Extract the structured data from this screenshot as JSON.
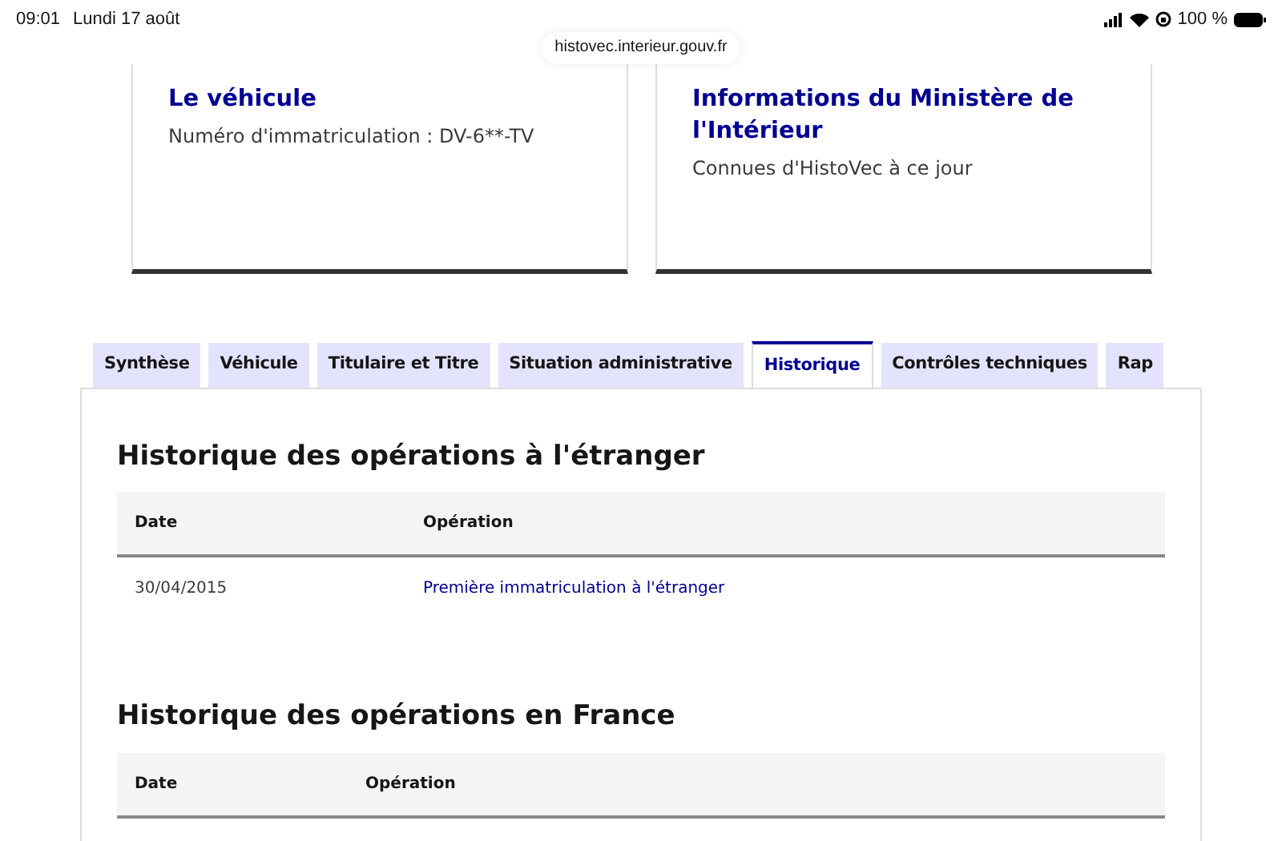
{
  "status_bar": {
    "time": "09:01",
    "date": "Lundi 17 août",
    "battery": "100 %",
    "url": "histovec.interieur.gouv.fr"
  },
  "cards": [
    {
      "title": "Le véhicule",
      "text": "Numéro d'immatriculation : DV-6**-TV"
    },
    {
      "title": "Informations du Ministère de l'Intérieur",
      "text": "Connues d'HistoVec à ce jour"
    }
  ],
  "tabs": [
    {
      "label": "Synthèse",
      "selected": false
    },
    {
      "label": "Véhicule",
      "selected": false
    },
    {
      "label": "Titulaire et Titre",
      "selected": false
    },
    {
      "label": "Situation administrative",
      "selected": false
    },
    {
      "label": "Historique",
      "selected": true
    },
    {
      "label": "Contrôles techniques",
      "selected": false
    },
    {
      "label": "Rap",
      "selected": false
    }
  ],
  "sections": [
    {
      "title": "Historique des opérations à l'étranger",
      "columns": [
        "Date",
        "Opération"
      ],
      "rows": [
        {
          "date": "30/04/2015",
          "operation": "Première immatriculation à l'étranger"
        }
      ]
    },
    {
      "title": "Historique des opérations en France",
      "columns": [
        "Date",
        "Opération"
      ]
    }
  ]
}
